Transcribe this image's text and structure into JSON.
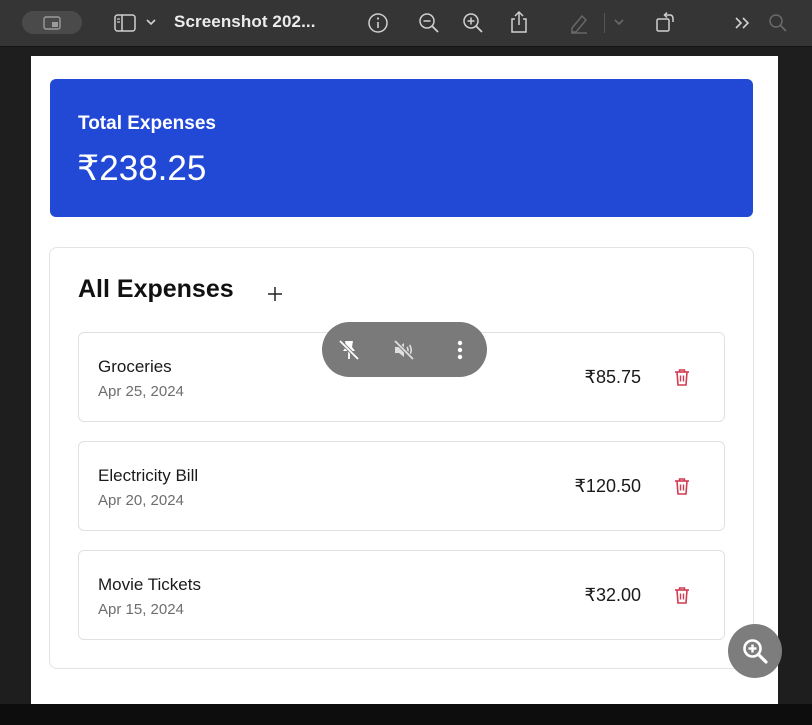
{
  "window": {
    "title": "Screenshot 202..."
  },
  "icons": {
    "toolbar": [
      "sidebar-toggle-icon",
      "chevron-down-icon",
      "info-icon",
      "zoom-out-icon",
      "zoom-in-icon",
      "share-icon",
      "markup-pen-icon",
      "rotate-icon",
      "more-chevrons-icon",
      "search-icon"
    ],
    "overlay": [
      "unpin-icon",
      "mute-icon",
      "more-vertical-icon",
      "zoom-in-icon"
    ],
    "content": [
      "plus-icon",
      "trash-icon"
    ]
  },
  "summary": {
    "label": "Total Expenses",
    "amount": "₹238.25",
    "background_color": "#2248d6"
  },
  "list": {
    "title": "All Expenses",
    "items": [
      {
        "name": "Groceries",
        "date": "Apr 25, 2024",
        "amount": "₹85.75"
      },
      {
        "name": "Electricity Bill",
        "date": "Apr 20, 2024",
        "amount": "₹120.50"
      },
      {
        "name": "Movie Tickets",
        "date": "Apr 15, 2024",
        "amount": "₹32.00"
      }
    ]
  },
  "colors": {
    "delete_icon": "#d23a52",
    "toolbar_bg": "#353535"
  }
}
